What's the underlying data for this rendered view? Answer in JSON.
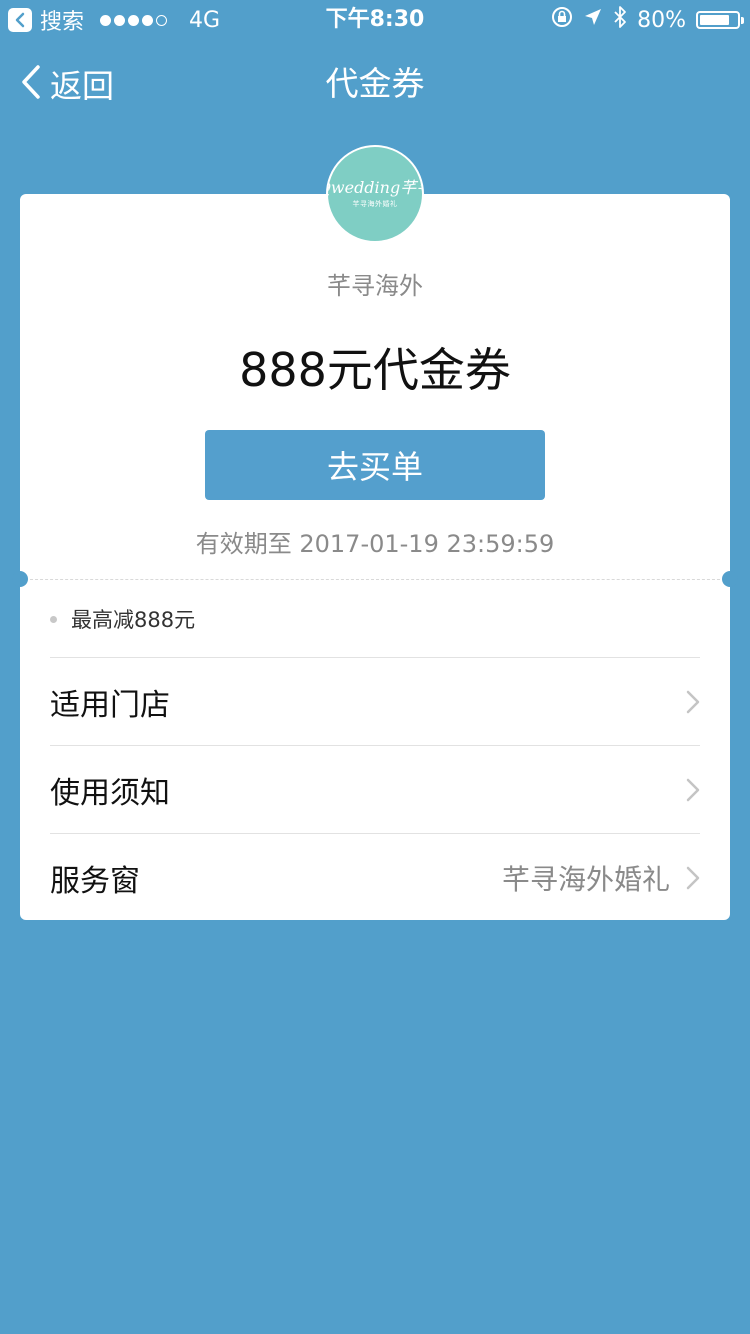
{
  "status_bar": {
    "app_label": "搜索",
    "network": "4G",
    "time": "下午8:30",
    "battery": "80%",
    "battery_level": 0.8
  },
  "nav": {
    "back_label": "返回",
    "title": "代金券"
  },
  "merchant": {
    "logo_script": "Qwedding芊寻",
    "logo_sub": "芊寻海外婚礼",
    "name": "芊寻海外"
  },
  "coupon": {
    "title": "888元代金券",
    "buy_label": "去买单",
    "validity": "有效期至 2017-01-19 23:59:59",
    "benefit": "最高减888元"
  },
  "rows": [
    {
      "label": "适用门店",
      "value": ""
    },
    {
      "label": "使用须知",
      "value": ""
    },
    {
      "label": "服务窗",
      "value": "芊寻海外婚礼"
    }
  ],
  "colors": {
    "background": "#529fcb",
    "button": "#549fcd",
    "logo": "#7fcec4"
  }
}
